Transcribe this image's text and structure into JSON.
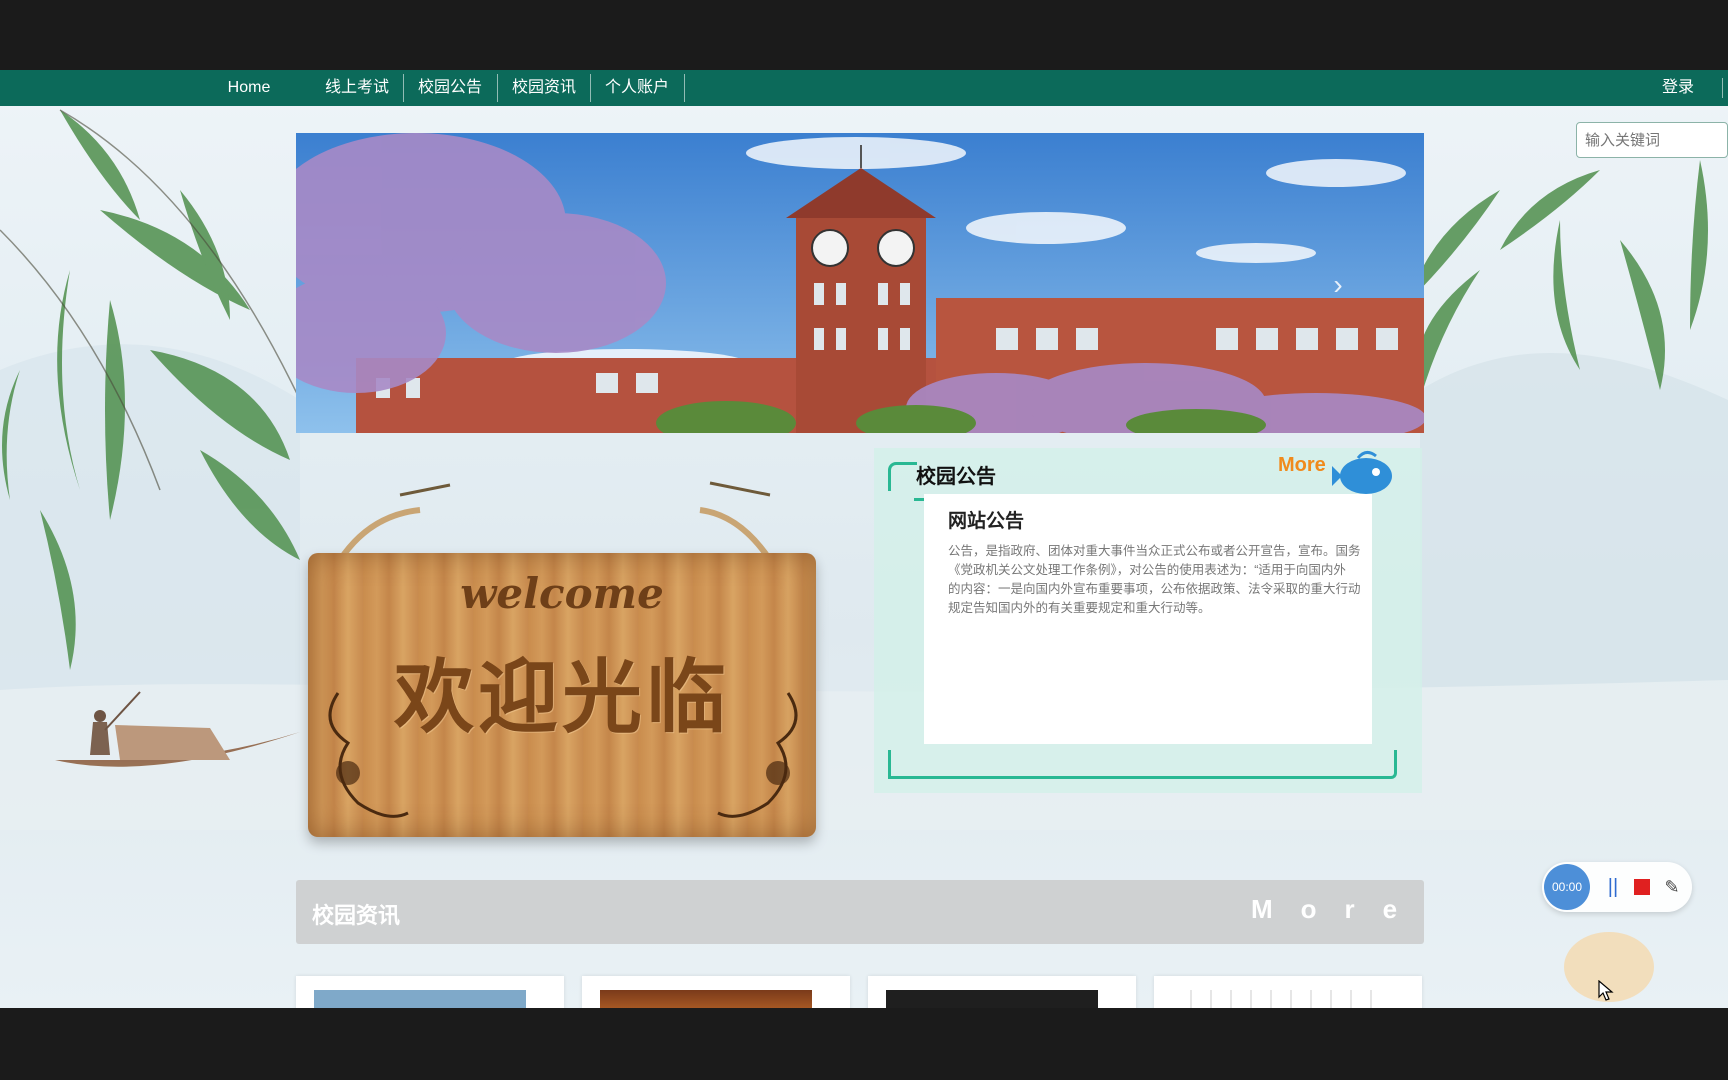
{
  "nav": {
    "home": "Home",
    "items": [
      "线上考试",
      "校园公告",
      "校园资讯",
      "个人账户"
    ],
    "login": "登录"
  },
  "search": {
    "placeholder": "输入关键词"
  },
  "sign": {
    "welcome": "welcome",
    "main": "欢迎光临"
  },
  "notice": {
    "title": "校园公告",
    "more": "More",
    "card_title": "网站公告",
    "lines": [
      "公告，是指政府、团体对重大事件当众正式公布或者公开宣告，宣布。国务",
      "《党政机关公文处理工作条例》，对公告的使用表述为：“适用于向国内外",
      "的内容：一是向国内外宣布重要事项，公布依据政策、法令采取的重大行动",
      "规定告知国内外的有关重要规定和重大行动等。"
    ]
  },
  "news": {
    "title": "校园资讯",
    "more": "More"
  },
  "recorder": {
    "time": "00:00",
    "pause": "||",
    "pen": "✎"
  },
  "colors": {
    "nav": "#0c6a5a",
    "accent": "#29b893",
    "more": "#f08a1c"
  }
}
